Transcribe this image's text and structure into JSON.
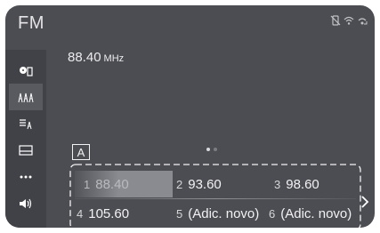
{
  "header": {
    "title": "FM",
    "status_icons": [
      "phone-disabled-icon",
      "wifi-icon",
      "signal-icon"
    ]
  },
  "sidebar": {
    "items": [
      {
        "icon": "source-disc-icon",
        "active": false
      },
      {
        "icon": "station-list-icon",
        "active": true
      },
      {
        "icon": "browse-list-icon",
        "active": false
      },
      {
        "icon": "screen-layout-icon",
        "active": false
      },
      {
        "icon": "more-options-icon",
        "active": false
      },
      {
        "icon": "volume-icon",
        "active": false
      }
    ]
  },
  "tuner": {
    "frequency": "88.40",
    "unit": "MHz"
  },
  "pager": {
    "pages": 2,
    "current": 1
  },
  "callout_label": "A",
  "presets": [
    {
      "num": "1",
      "value": "88.40",
      "selected": true
    },
    {
      "num": "2",
      "value": "93.60",
      "selected": false
    },
    {
      "num": "3",
      "value": "98.60",
      "selected": false
    },
    {
      "num": "4",
      "value": "105.60",
      "selected": false
    },
    {
      "num": "5",
      "value": "(Adic. novo)",
      "selected": false
    },
    {
      "num": "6",
      "value": "(Adic. novo)",
      "selected": false
    }
  ]
}
